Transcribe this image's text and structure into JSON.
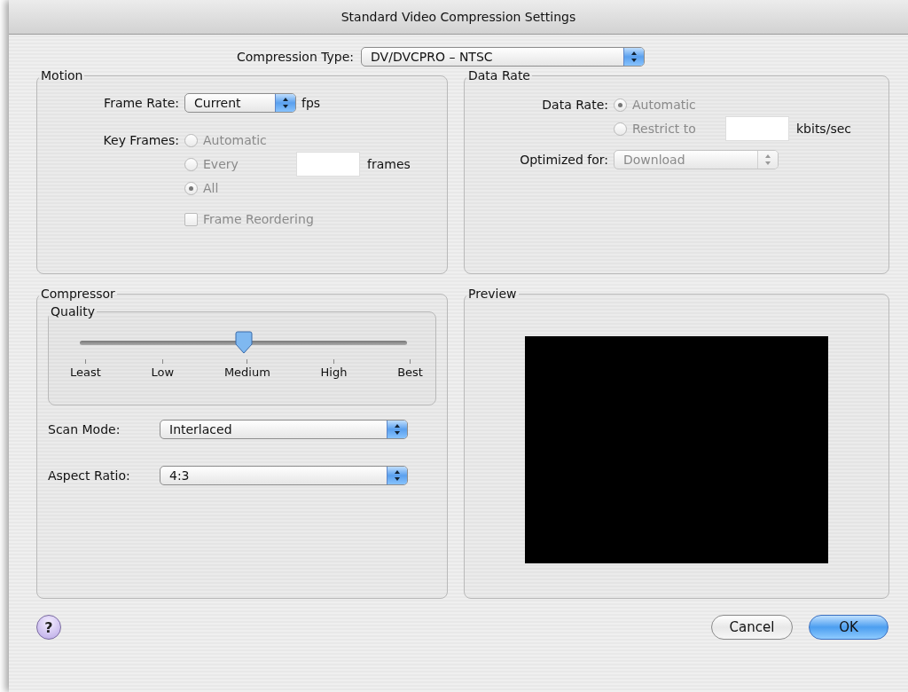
{
  "window": {
    "title": "Standard Video Compression Settings"
  },
  "compression_type": {
    "label": "Compression Type:",
    "value": "DV/DVCPRO – NTSC",
    "disabled": false
  },
  "motion": {
    "title": "Motion",
    "frame_rate": {
      "label": "Frame Rate:",
      "value": "Current",
      "unit": "fps",
      "disabled": false
    },
    "key_frames": {
      "label": "Key Frames:",
      "disabled": true,
      "options": [
        {
          "label": "Automatic",
          "selected": false,
          "kind": "plain"
        },
        {
          "label": "Every",
          "selected": false,
          "kind": "with_field",
          "unit": "frames"
        },
        {
          "label": "All",
          "selected": true,
          "kind": "plain"
        }
      ]
    },
    "frame_reordering": {
      "label": "Frame Reordering",
      "checked": false,
      "disabled": true
    }
  },
  "data_rate": {
    "title": "Data Rate",
    "label": "Data Rate:",
    "disabled": true,
    "options": [
      {
        "label": "Automatic",
        "selected": true,
        "kind": "plain"
      },
      {
        "label": "Restrict to",
        "selected": false,
        "kind": "with_field",
        "unit": "kbits/sec"
      }
    ],
    "optimized_for": {
      "label": "Optimized for:",
      "value": "Download",
      "disabled": true
    }
  },
  "compressor": {
    "title": "Compressor",
    "quality": {
      "title": "Quality",
      "level": 0.5,
      "ticks": [
        "Least",
        "Low",
        "Medium",
        "High",
        "Best"
      ]
    },
    "scan_mode": {
      "label": "Scan Mode:",
      "value": "Interlaced",
      "disabled": false
    },
    "aspect_ratio": {
      "label": "Aspect Ratio:",
      "value": "4:3",
      "disabled": false
    }
  },
  "preview": {
    "title": "Preview"
  },
  "help": "?",
  "buttons": [
    {
      "label": "Cancel",
      "kind": "normal"
    },
    {
      "label": "OK",
      "kind": "default"
    }
  ]
}
